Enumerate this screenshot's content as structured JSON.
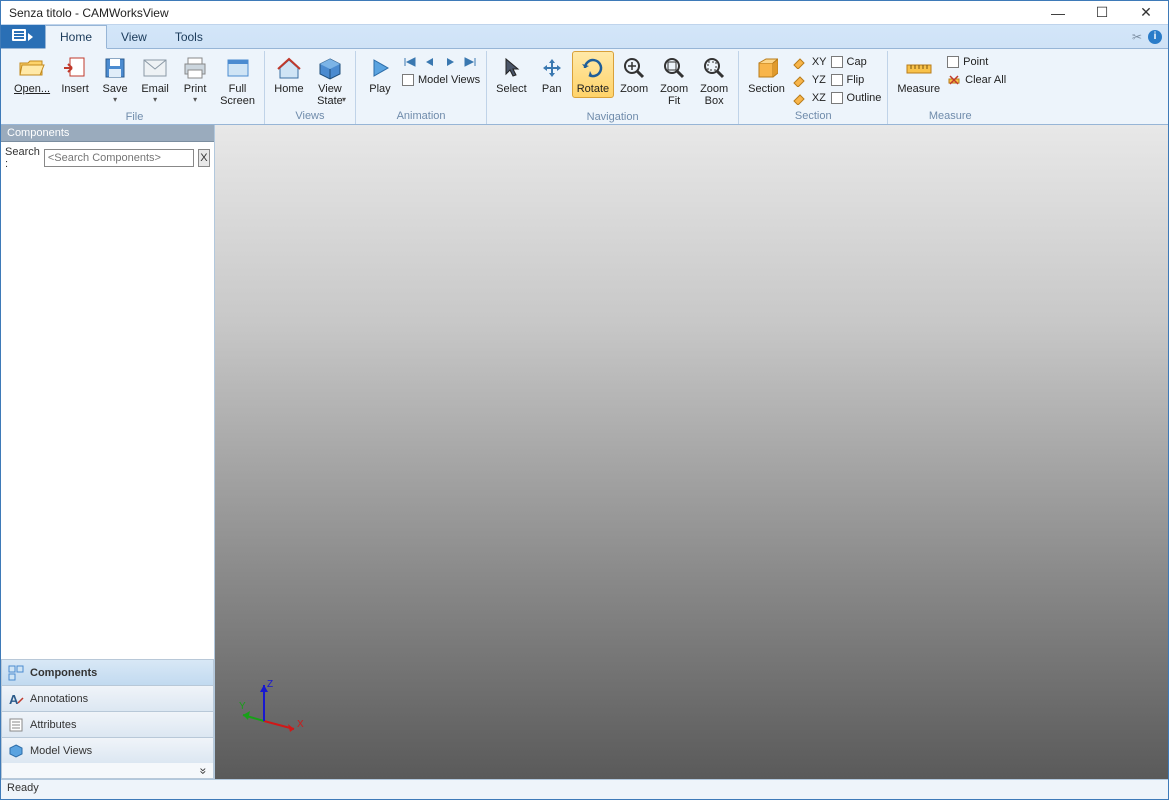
{
  "title": "Senza titolo - CAMWorksView",
  "tabs": {
    "home": "Home",
    "view": "View",
    "tools": "Tools"
  },
  "ribbon": {
    "file": {
      "label": "File",
      "open": "Open...",
      "insert": "Insert",
      "save": "Save",
      "email": "Email",
      "print": "Print",
      "fullscreen": "Full\nScreen"
    },
    "views": {
      "label": "Views",
      "home": "Home",
      "viewstate": "View\nState"
    },
    "animation": {
      "label": "Animation",
      "play": "Play",
      "modelviews": "Model Views"
    },
    "navigation": {
      "label": "Navigation",
      "select": "Select",
      "pan": "Pan",
      "rotate": "Rotate",
      "zoom": "Zoom",
      "zoomfit": "Zoom\nFit",
      "zoombox": "Zoom\nBox"
    },
    "section": {
      "label": "Section",
      "section": "Section",
      "xy": "XY",
      "yz": "YZ",
      "xz": "XZ",
      "cap": "Cap",
      "flip": "Flip",
      "outline": "Outline"
    },
    "measure": {
      "label": "Measure",
      "measure": "Measure",
      "point": "Point",
      "clearall": "Clear All"
    }
  },
  "sidebar": {
    "panel_title": "Components",
    "search_label": "Search :",
    "search_placeholder": "<Search Components>",
    "xbtn": "X",
    "nav": {
      "components": "Components",
      "annotations": "Annotations",
      "attributes": "Attributes",
      "modelviews": "Model Views"
    },
    "expander": "»"
  },
  "status": "Ready",
  "viewport": {
    "axes": [
      "X",
      "Y",
      "Z"
    ]
  }
}
